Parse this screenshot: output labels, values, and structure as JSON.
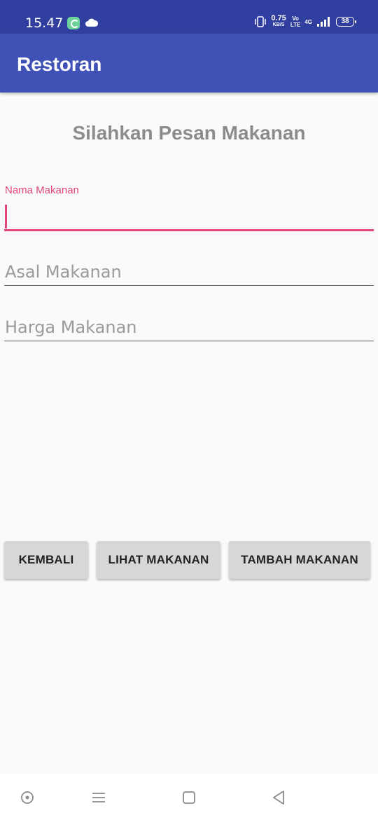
{
  "status_bar": {
    "time": "15.47",
    "net_speed_value": "0.75",
    "net_speed_unit": "KB/S",
    "volte_top": "Vo",
    "volte_bottom": "LTE",
    "network_type": "4G",
    "battery": "38"
  },
  "app_bar": {
    "title": "Restoran"
  },
  "heading": "Silahkan Pesan Makanan",
  "form": {
    "nama_label": "Nama Makanan",
    "nama_value": "",
    "asal_placeholder": "Asal Makanan",
    "harga_placeholder": "Harga Makanan"
  },
  "buttons": {
    "kembali": "KEMBALI",
    "lihat": "LIHAT MAKANAN",
    "tambah": "TAMBAH MAKANAN"
  },
  "icons": {
    "assist": "assist-icon",
    "menu": "menu-icon",
    "home": "home-icon",
    "back": "back-icon"
  },
  "colors": {
    "status_bar": "#303f9f",
    "app_bar": "#3f51b5",
    "accent": "#e0457b",
    "button": "#d6d7d7"
  }
}
